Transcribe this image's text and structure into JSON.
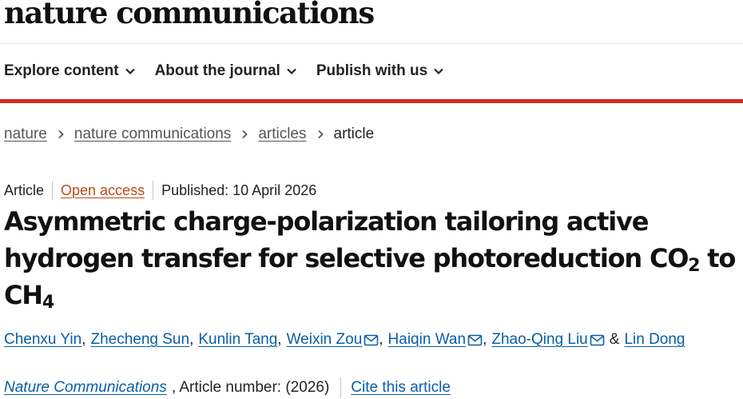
{
  "header": {
    "brand": "nature communications"
  },
  "nav": {
    "items": [
      {
        "label": "Explore content"
      },
      {
        "label": "About the journal"
      },
      {
        "label": "Publish with us"
      }
    ]
  },
  "breadcrumb": {
    "items": [
      "nature",
      "nature communications",
      "articles"
    ],
    "current": "article"
  },
  "meta": {
    "type": "Article",
    "access": "Open access",
    "published": "Published: 10 April 2026"
  },
  "title": {
    "part1": "Asymmetric charge-polarization tailoring active hydrogen transfer for selective photoreduction CO",
    "sub1": "2",
    "part2": " to CH",
    "sub2": "4"
  },
  "authors": [
    {
      "name": "Chenxu Yin",
      "email": false,
      "sep": ","
    },
    {
      "name": "Zhecheng Sun",
      "email": false,
      "sep": ","
    },
    {
      "name": "Kunlin Tang",
      "email": false,
      "sep": ","
    },
    {
      "name": "Weixin Zou",
      "email": true,
      "sep": ","
    },
    {
      "name": "Haiqin Wan",
      "email": true,
      "sep": ","
    },
    {
      "name": "Zhao-Qing Liu",
      "email": true,
      "sep": "&"
    },
    {
      "name": "Lin Dong",
      "email": false,
      "sep": ""
    }
  ],
  "journal": {
    "name": "Nature Communications",
    "article_number": ", Article number:  (2026)",
    "cite": "Cite this article"
  },
  "colors": {
    "accent_bar": "#d22b25",
    "link": "#0a5ea8",
    "open_access": "#b94a1a"
  }
}
